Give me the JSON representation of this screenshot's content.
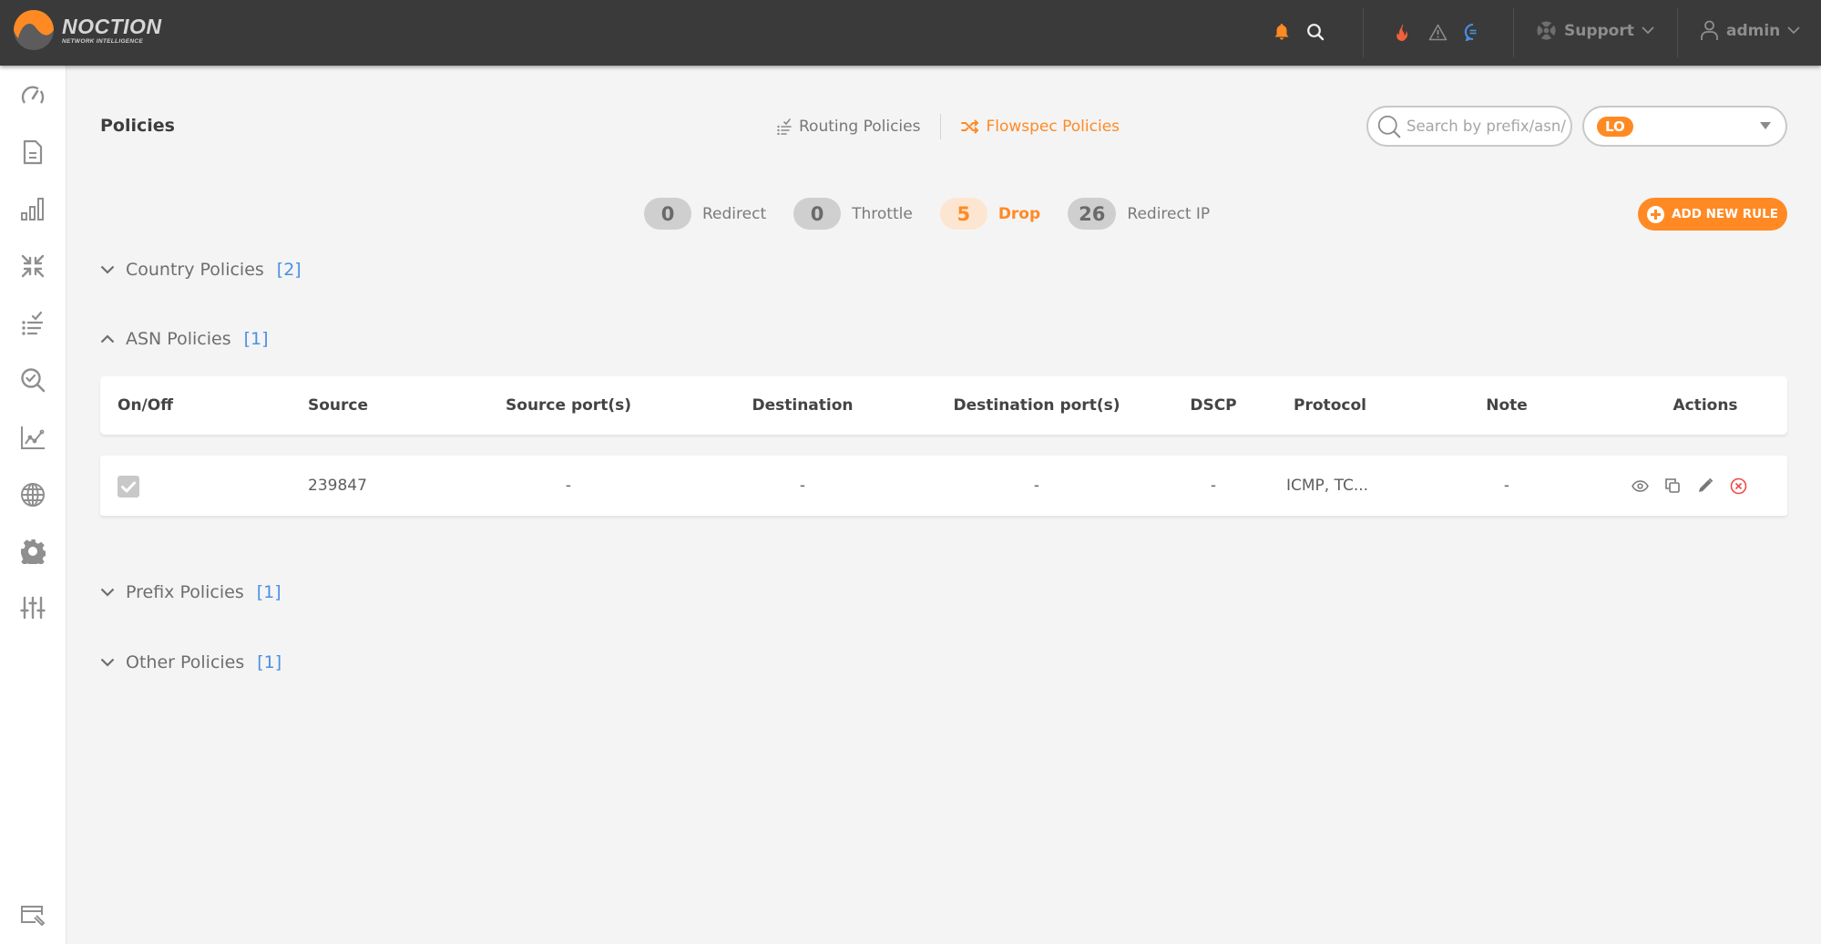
{
  "header": {
    "brand_name": "NOCTION",
    "brand_tagline": "NETWORK INTELLIGENCE",
    "icons": [
      "bell-icon",
      "search-icon",
      "fire-icon",
      "warning-icon",
      "chat-icon"
    ],
    "support_label": "Support",
    "user_label": "admin",
    "colors": {
      "bar": "#3a3a3a",
      "bell": "#ff8a24",
      "fire": "#f2613a",
      "chat": "#4a90e2"
    }
  },
  "sidebar": {
    "items": [
      {
        "icon": "dashboard-gauge-icon"
      },
      {
        "icon": "reports-document-icon"
      },
      {
        "icon": "bar-chart-icon"
      },
      {
        "icon": "collapse-arrows-icon"
      },
      {
        "icon": "checklist-icon"
      },
      {
        "icon": "search-check-icon"
      },
      {
        "icon": "line-chart-icon"
      },
      {
        "icon": "globe-icon"
      },
      {
        "icon": "gear-icon"
      },
      {
        "icon": "sliders-icon"
      }
    ],
    "bottom_item": {
      "icon": "window-wrench-icon"
    }
  },
  "page": {
    "title": "Policies",
    "tabs": [
      {
        "label": "Routing Policies",
        "icon": "checklist-icon",
        "active": false
      },
      {
        "label": "Flowspec Policies",
        "icon": "shuffle-icon",
        "active": true
      }
    ],
    "search": {
      "placeholder": "Search by prefix/asn/",
      "value": ""
    },
    "filter_select": {
      "selected": "LO"
    },
    "counters": [
      {
        "count": "0",
        "label": "Redirect",
        "active": false
      },
      {
        "count": "0",
        "label": "Throttle",
        "active": false
      },
      {
        "count": "5",
        "label": "Drop",
        "active": true
      },
      {
        "count": "26",
        "label": "Redirect IP",
        "active": false
      }
    ],
    "add_button_label": "ADD NEW RULE",
    "accent_color": "#ff8a24"
  },
  "sections": [
    {
      "title": "Country Policies",
      "count": "[2]",
      "expanded": false
    },
    {
      "title": "ASN Policies",
      "count": "[1]",
      "expanded": true
    },
    {
      "title": "Prefix Policies",
      "count": "[1]",
      "expanded": false
    },
    {
      "title": "Other Policies",
      "count": "[1]",
      "expanded": false
    }
  ],
  "asn_table": {
    "columns": [
      "On/Off",
      "Source",
      "Source port(s)",
      "Destination",
      "Destination port(s)",
      "DSCP",
      "Protocol",
      "Note",
      "Actions"
    ],
    "rows": [
      {
        "enabled": true,
        "source": "239847",
        "source_ports": "-",
        "destination": "-",
        "destination_ports": "-",
        "dscp": "-",
        "protocol": "ICMP, TC...",
        "note": "-",
        "actions": [
          "view-icon",
          "copy-icon",
          "edit-pencil-icon",
          "delete-icon"
        ]
      }
    ]
  }
}
